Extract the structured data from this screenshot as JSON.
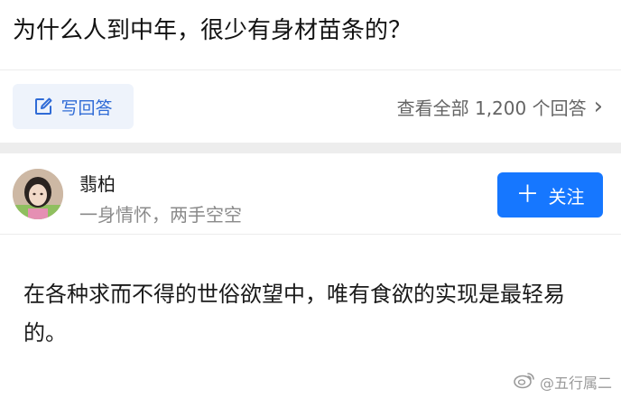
{
  "question": {
    "title": "为什么人到中年，很少有身材苗条的？"
  },
  "actions": {
    "write_answer_label": "写回答",
    "view_all_label": "查看全部 1,200 个回答",
    "chevron": "›"
  },
  "author": {
    "name": "翡柏",
    "bio": "一身情怀，两手空空",
    "follow_plus": "＋",
    "follow_label": "关注"
  },
  "answer": {
    "text": "在各种求而不得的世俗欲望中，唯有食欲的实现是最轻易的。"
  },
  "watermark": {
    "text": "@五行属二"
  },
  "colors": {
    "accent": "#1677ff",
    "write_answer_text": "#2f6bd6",
    "write_answer_bg": "#eef3fb",
    "divider": "#ededed"
  },
  "icons": {
    "write_answer": "edit-icon",
    "view_all": "chevron-right-icon",
    "follow": "plus-icon",
    "watermark": "weibo-logo-icon"
  }
}
